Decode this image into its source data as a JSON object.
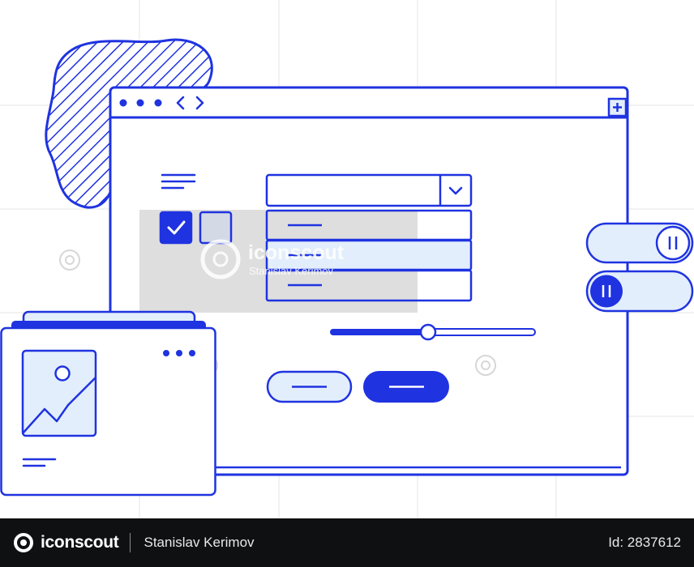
{
  "watermark": {
    "brand": "iconscout",
    "author": "Stanislav Kerimov"
  },
  "footer": {
    "brand": "iconscout",
    "author": "Stanislav Kerimov",
    "image_id": "Id: 2837612"
  },
  "colors": {
    "primary": "#1f33e0",
    "light_fill": "#e3eefc",
    "grid": "#e6e6e6",
    "checkbox_off": "#d3dae6",
    "footer_bg": "#0f1012"
  },
  "icons": {
    "window_controls": [
      "dot",
      "dot",
      "dot",
      "chevron-left",
      "chevron-right"
    ],
    "new_tab": "plus-icon",
    "select": "chevron-down-icon",
    "toggle": "pause-icon",
    "card": "image-icon"
  },
  "form": {
    "checkbox_checked": true,
    "checkbox_unchecked": false,
    "slider_value_fraction": 0.48,
    "toggle_top_on": false,
    "toggle_bottom_on": true,
    "dropdown_highlighted_index": 1
  }
}
